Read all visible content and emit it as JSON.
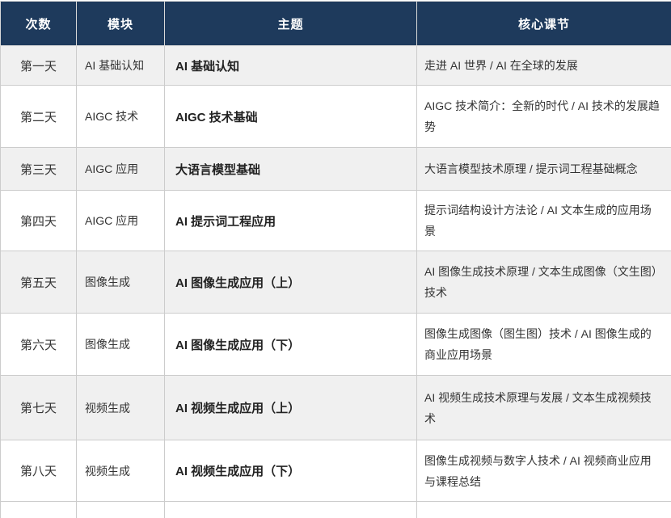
{
  "theme": {
    "header_bg": "#1e3a5c",
    "header_text": "#ffffff",
    "row_bg": "#ffffff",
    "row_alt_bg": "#f0f0f0",
    "border_color": "#cccccc",
    "body_text": "#333333",
    "topic_text": "#222222"
  },
  "table": {
    "columns": [
      {
        "key": "day",
        "label": "次数"
      },
      {
        "key": "module",
        "label": "模块"
      },
      {
        "key": "topic",
        "label": "主题"
      },
      {
        "key": "lessons",
        "label": "核心课节"
      }
    ],
    "rows": [
      {
        "day": "第一天",
        "module": "AI 基础认知",
        "topic": "AI 基础认知",
        "lessons": "走进 AI 世界 / AI 在全球的发展"
      },
      {
        "day": "第二天",
        "module": "AIGC 技术",
        "topic": "AIGC 技术基础",
        "lessons": "AIGC 技术简介：全新的时代 / AI 技术的发展趋势"
      },
      {
        "day": "第三天",
        "module": "AIGC 应用",
        "topic": "大语言模型基础",
        "lessons": "大语言模型技术原理 / 提示词工程基础概念"
      },
      {
        "day": "第四天",
        "module": "AIGC 应用",
        "topic": "AI 提示词工程应用",
        "lessons": "提示词结构设计方法论 / AI 文本生成的应用场景"
      },
      {
        "day": "第五天",
        "module": "图像生成",
        "topic": "AI 图像生成应用（上）",
        "lessons": "AI 图像生成技术原理 / 文本生成图像（文生图）技术"
      },
      {
        "day": "第六天",
        "module": "图像生成",
        "topic": "AI 图像生成应用（下）",
        "lessons": "图像生成图像（图生图）技术 / AI 图像生成的商业应用场景"
      },
      {
        "day": "第七天",
        "module": "视频生成",
        "topic": "AI 视频生成应用（上）",
        "lessons": "AI 视频生成技术原理与发展 / 文本生成视频技术"
      },
      {
        "day": "第八天",
        "module": "视频生成",
        "topic": "AI 视频生成应用（下）",
        "lessons": "图像生成视频与数字人技术 / AI 视频商业应用与课程总结"
      }
    ]
  }
}
